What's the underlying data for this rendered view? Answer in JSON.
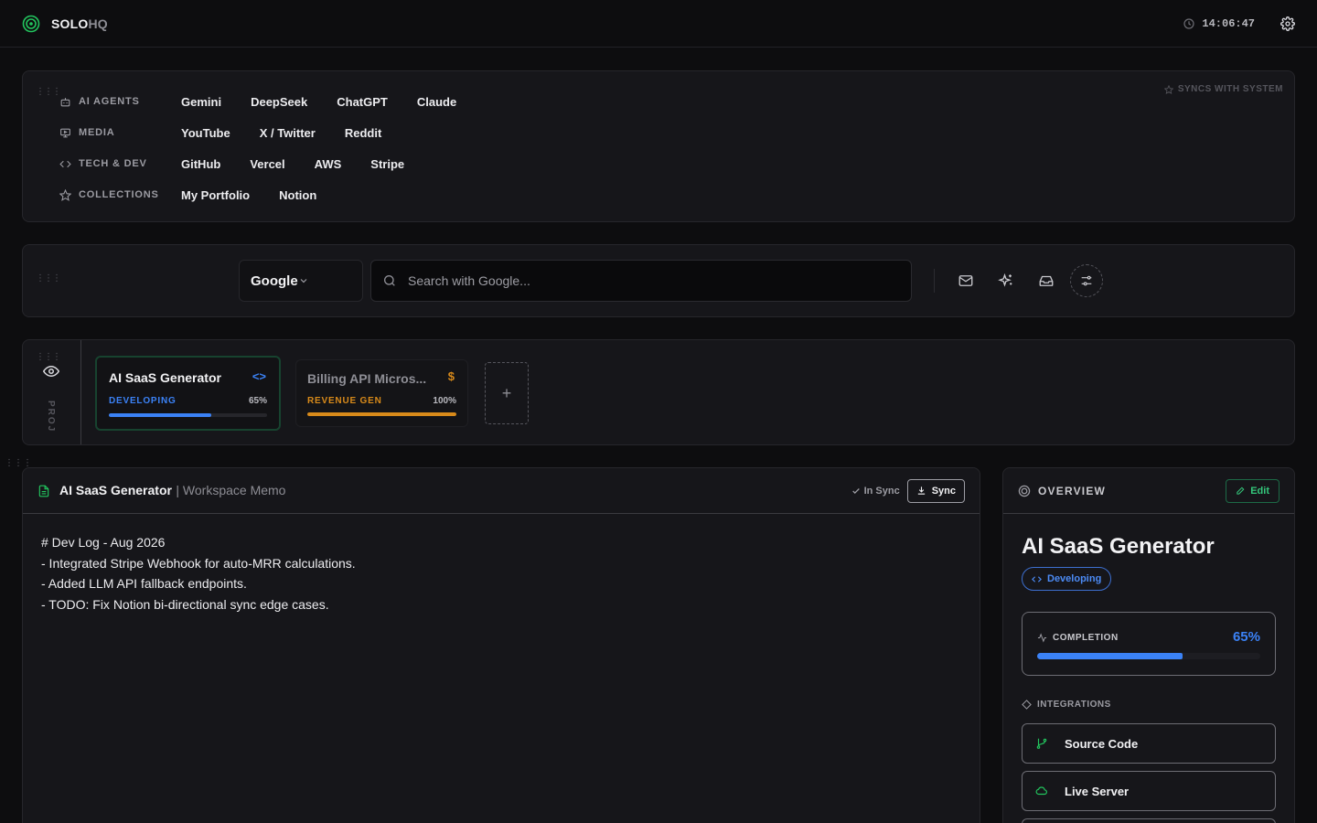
{
  "app": {
    "name_primary": "SOLO",
    "name_secondary": "HQ",
    "clock": "14:06:47"
  },
  "bookmarks": {
    "sync_label": "SYNCS WITH SYSTEM",
    "categories": [
      {
        "label": "AI AGENTS",
        "icon": "robot-icon",
        "links": [
          "Gemini",
          "DeepSeek",
          "ChatGPT",
          "Claude"
        ]
      },
      {
        "label": "MEDIA",
        "icon": "monitor-icon",
        "links": [
          "YouTube",
          "X / Twitter",
          "Reddit"
        ]
      },
      {
        "label": "TECH & DEV",
        "icon": "code-icon",
        "links": [
          "GitHub",
          "Vercel",
          "AWS",
          "Stripe"
        ]
      },
      {
        "label": "COLLECTIONS",
        "icon": "star-icon",
        "links": [
          "My Portfolio",
          "Notion"
        ]
      }
    ]
  },
  "search": {
    "engine": "Google",
    "placeholder": "Search with Google...",
    "tools": [
      "mail-icon",
      "sparkles-icon",
      "inbox-icon",
      "sliders-icon"
    ]
  },
  "projects": {
    "side_label": "PROJ",
    "items": [
      {
        "title": "AI SaaS Generator",
        "status": "DEVELOPING",
        "percent_label": "65%",
        "progress": 0.65,
        "icon": "<>",
        "color": "#3b82f6"
      },
      {
        "title": "Billing API Micros...",
        "status": "REVENUE GEN",
        "percent_label": "100%",
        "progress": 1.0,
        "icon": "$",
        "color": "#d88a1a"
      }
    ],
    "add_label": "+"
  },
  "memo": {
    "title": "AI SaaS Generator",
    "subtitle": "| Workspace Memo",
    "status": "In Sync",
    "sync_button": "Sync",
    "lines": [
      "# Dev Log - Aug 2026",
      "- Integrated Stripe Webhook for auto-MRR calculations.",
      "- Added LLM API fallback endpoints.",
      "- TODO: Fix Notion bi-directional sync edge cases."
    ]
  },
  "overview": {
    "label": "OVERVIEW",
    "edit_button": "Edit",
    "title": "AI SaaS Generator",
    "status": "Developing",
    "completion_label": "COMPLETION",
    "completion_pct": "65%",
    "completion": 0.65,
    "integrations_label": "INTEGRATIONS",
    "integrations": [
      {
        "label": "Source Code",
        "icon": "git-branch-icon"
      },
      {
        "label": "Live Server",
        "icon": "cloud-icon"
      }
    ]
  },
  "colors": {
    "accent_green": "#22c55e",
    "accent_blue": "#3b82f6",
    "accent_orange": "#d88a1a"
  }
}
